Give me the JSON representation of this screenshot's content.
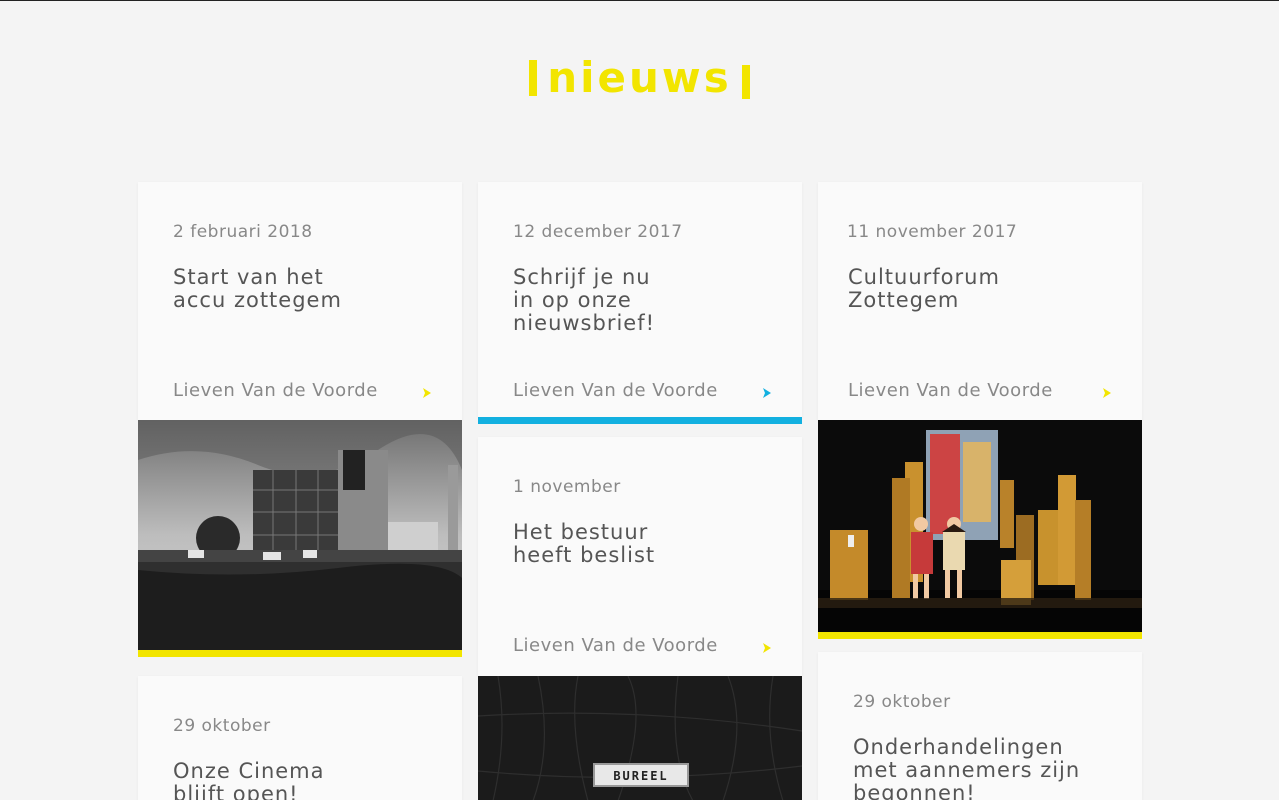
{
  "page": {
    "heading": "nieuws"
  },
  "colors": {
    "yellow": "#f2e500",
    "blue": "#12b0e0",
    "background": "#f4f4f4",
    "card": "#fafafa"
  },
  "cards": [
    {
      "date": "2 februari 2018",
      "title": "Start van het accu zottegem",
      "author": "Lieven Van de Voorde",
      "arrow_icon": "chevron-right-icon",
      "accent": "yellow"
    },
    {
      "date": "12 december 2017",
      "title": "Schrijf je nu in op onze nieuwsbrief!",
      "author": "Lieven Van de Voorde",
      "arrow_icon": "chevron-right-icon",
      "accent": "blue"
    },
    {
      "date": "11 november 2017",
      "title": "Cultuurforum Zottegem",
      "author": "Lieven Van de Voorde",
      "arrow_icon": "chevron-right-icon",
      "accent": "yellow"
    },
    {
      "date": "1 november",
      "title": "Het bestuur heeft beslist",
      "author": "Lieven Van de Voorde",
      "arrow_icon": "chevron-right-icon",
      "accent": "yellow"
    },
    {
      "date": "29 oktober",
      "title": "Onze Cinema blijft open!",
      "author": "",
      "arrow_icon": "",
      "accent": ""
    },
    {
      "date": "29 oktober",
      "title": "Onderhandelingen met aannemers zijn begonnen!",
      "author": "",
      "arrow_icon": "",
      "accent": ""
    }
  ],
  "photos": {
    "sign_text": "BUREEL"
  }
}
